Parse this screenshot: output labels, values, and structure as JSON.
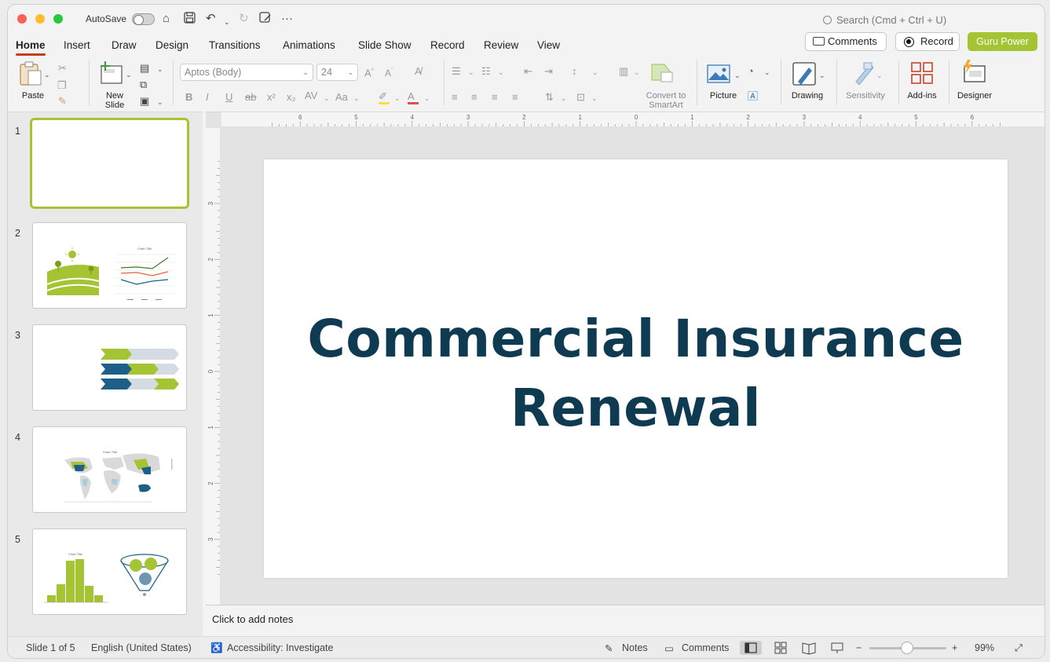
{
  "titlebar": {
    "autosave_label": "AutoSave",
    "search_placeholder": "Search (Cmd + Ctrl + U)"
  },
  "menu": {
    "tabs": [
      {
        "label": "Home"
      },
      {
        "label": "Insert"
      },
      {
        "label": "Draw"
      },
      {
        "label": "Design"
      },
      {
        "label": "Transitions"
      },
      {
        "label": "Animations"
      },
      {
        "label": "Slide Show"
      },
      {
        "label": "Record"
      },
      {
        "label": "Review"
      },
      {
        "label": "View"
      }
    ],
    "active_tab": "Home",
    "comments_button": "Comments",
    "record_button": "Record",
    "guru_button": "Guru Power"
  },
  "ribbon": {
    "paste": "Paste",
    "new_slide": "New Slide",
    "font_name": "Aptos (Body)",
    "font_size": "24",
    "convert_smartart": "Convert to SmartArt",
    "picture": "Picture",
    "drawing": "Drawing",
    "sensitivity": "Sensitivity",
    "addins": "Add-ins",
    "designer": "Designer"
  },
  "slides": {
    "numbers": [
      "1",
      "2",
      "3",
      "4",
      "5"
    ],
    "thumb_chart_title": "Chart Title"
  },
  "slide": {
    "title_line1": "Commercial Insurance",
    "title_line2": "Renewal"
  },
  "notes": {
    "placeholder": "Click to add notes"
  },
  "status": {
    "slide_counter": "Slide 1 of 5",
    "language": "English (United States)",
    "accessibility": "Accessibility: Investigate",
    "notes": "Notes",
    "comments": "Comments",
    "zoom": "99%"
  },
  "colors": {
    "accent_green": "#a4c434",
    "navy": "#0e3a52",
    "tab_underline": "#c43e1c",
    "mid_blue": "#1d5f86"
  }
}
